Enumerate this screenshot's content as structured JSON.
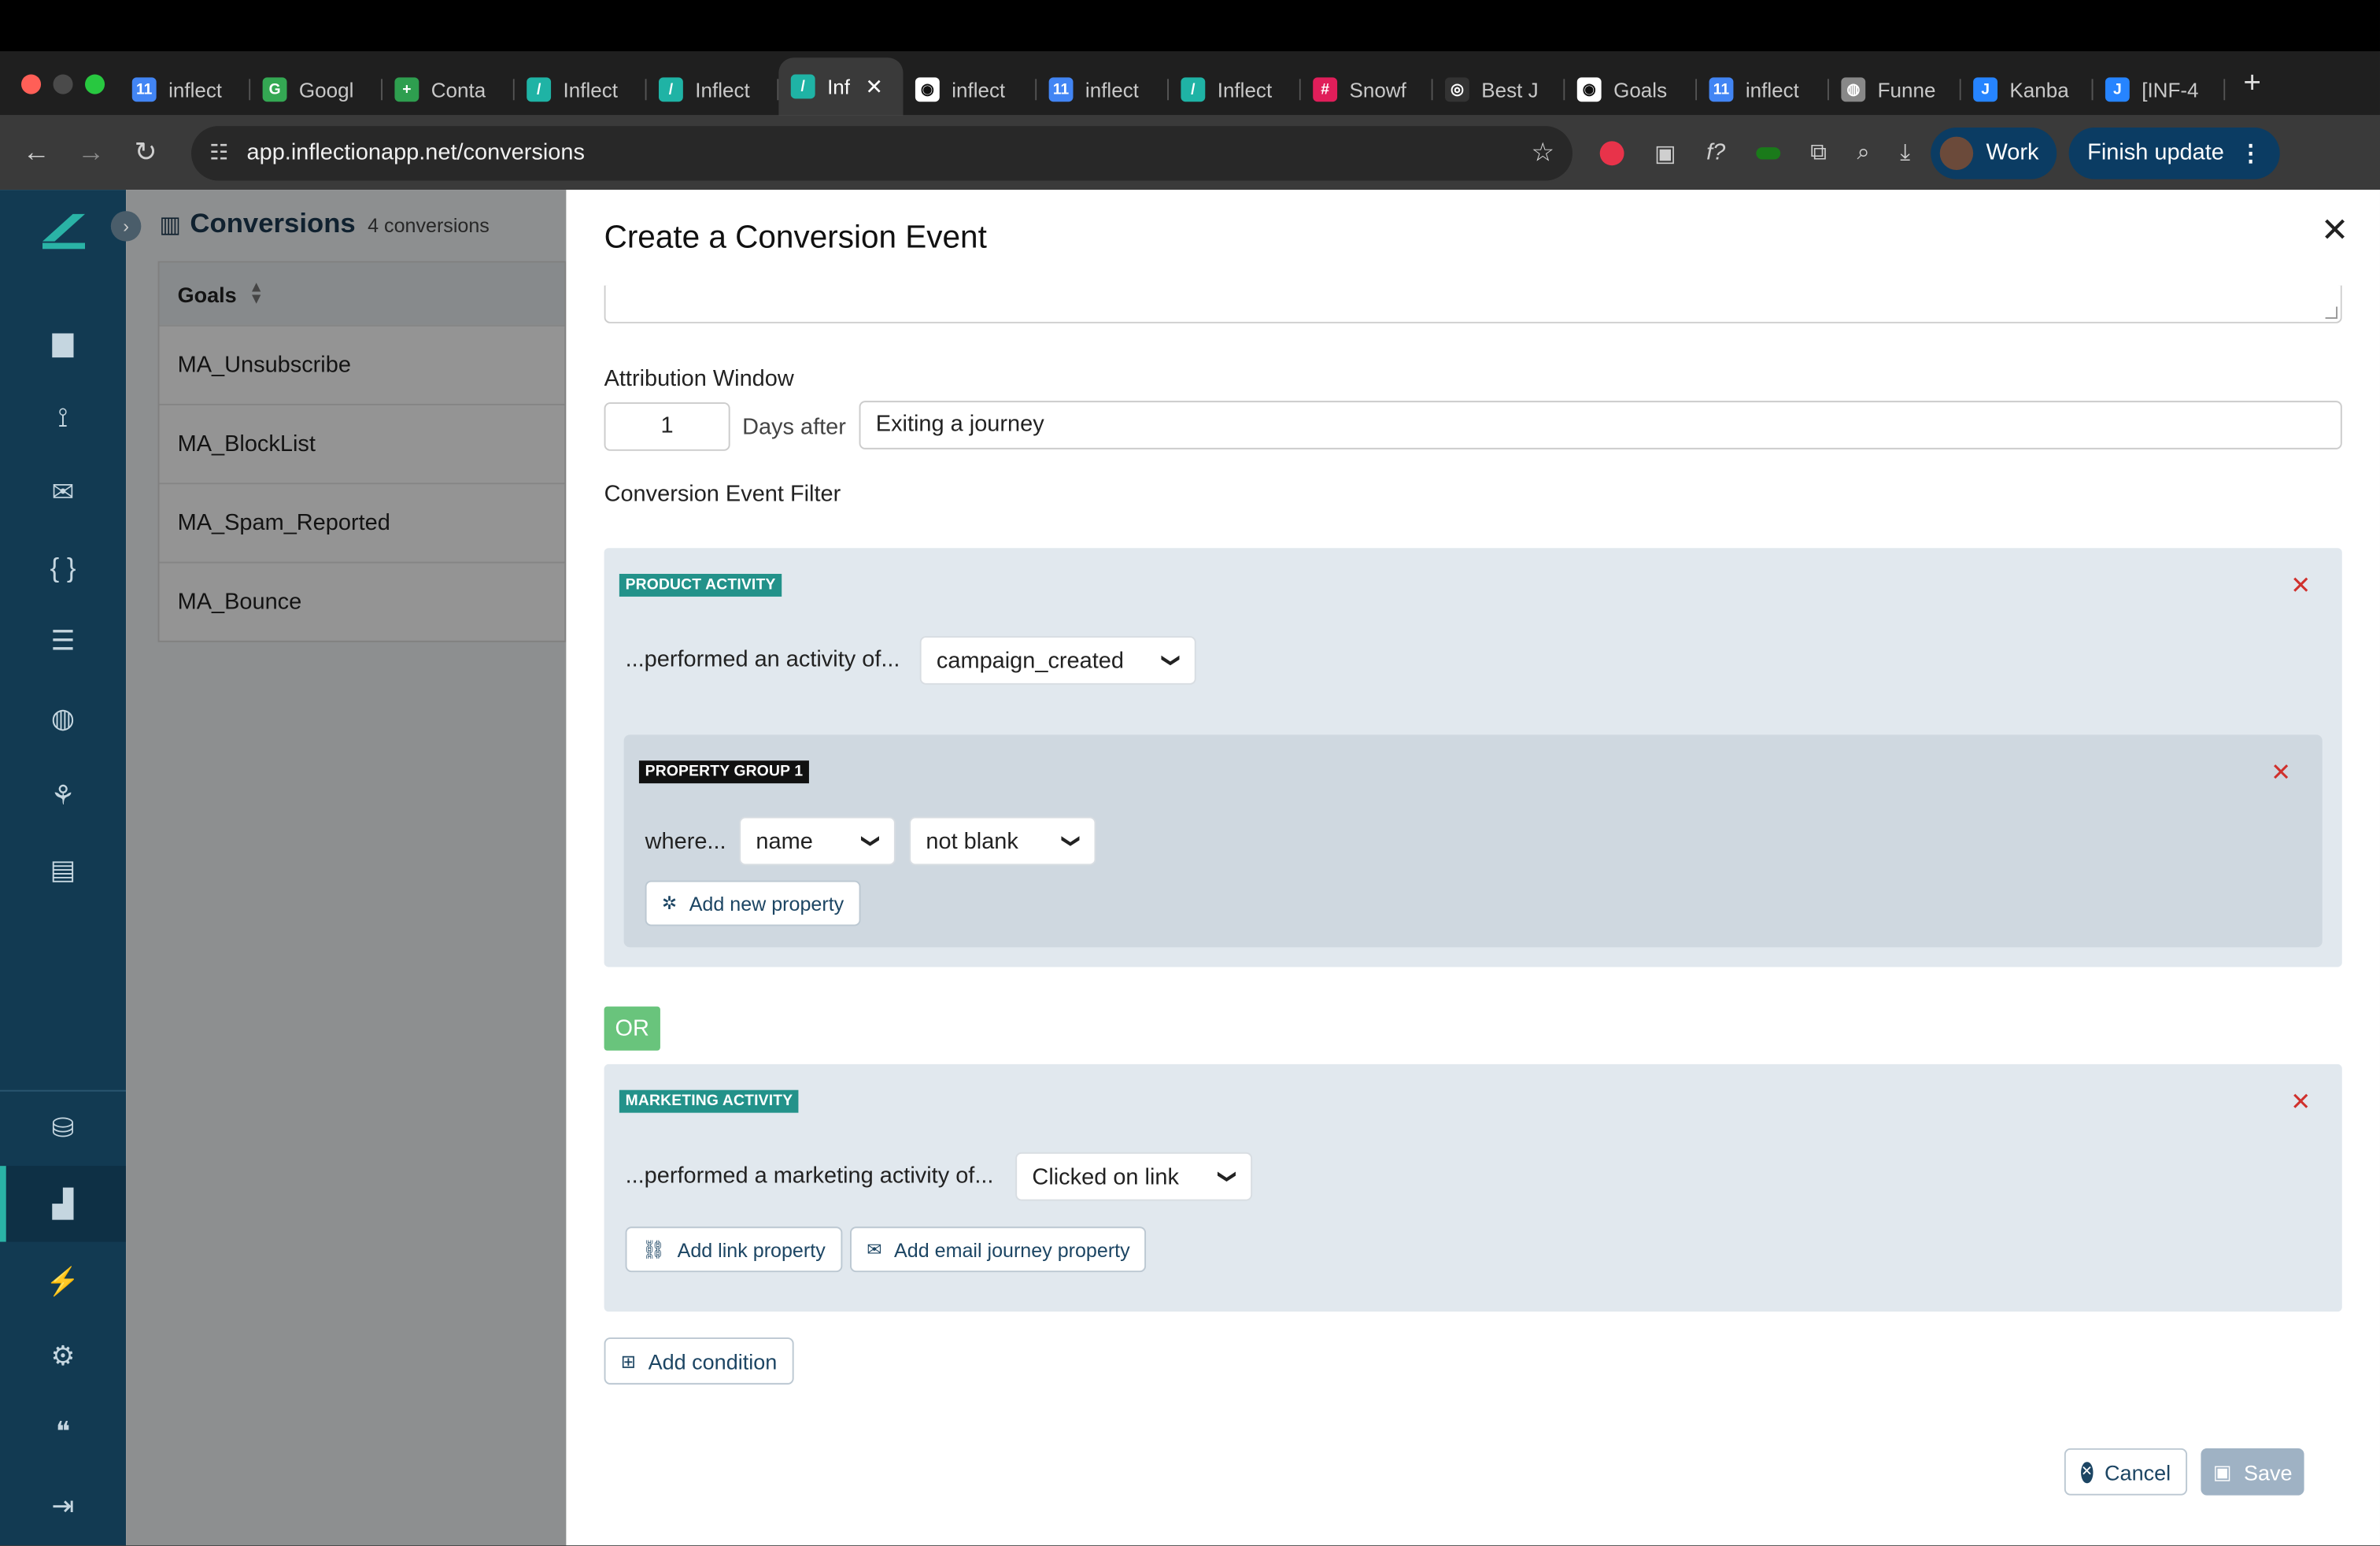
{
  "browser": {
    "tabs": [
      {
        "title": "inflect",
        "fav_color": "#4285f4",
        "fav_glyph": "11"
      },
      {
        "title": "Googl",
        "fav_color": "#34a853",
        "fav_glyph": "G"
      },
      {
        "title": "Conta",
        "fav_color": "#2e9e4f",
        "fav_glyph": "+"
      },
      {
        "title": "Inflect",
        "fav_color": "#1fb3a5",
        "fav_glyph": "/"
      },
      {
        "title": "Inflect",
        "fav_color": "#1fb3a5",
        "fav_glyph": "/"
      },
      {
        "title": "Inf",
        "fav_color": "#1fb3a5",
        "fav_glyph": "/",
        "active": true
      },
      {
        "title": "inflect",
        "fav_color": "#ffffff",
        "fav_glyph": "◉"
      },
      {
        "title": "inflect",
        "fav_color": "#4285f4",
        "fav_glyph": "11"
      },
      {
        "title": "Inflect",
        "fav_color": "#1fb3a5",
        "fav_glyph": "/"
      },
      {
        "title": "Snowf",
        "fav_color": "#e01e5a",
        "fav_glyph": "#"
      },
      {
        "title": "Best J",
        "fav_color": "#333333",
        "fav_glyph": "◎"
      },
      {
        "title": "Goals",
        "fav_color": "#ffffff",
        "fav_glyph": "◉"
      },
      {
        "title": "inflect",
        "fav_color": "#4285f4",
        "fav_glyph": "11"
      },
      {
        "title": "Funne",
        "fav_color": "#888888",
        "fav_glyph": "◍"
      },
      {
        "title": "Kanba",
        "fav_color": "#2684ff",
        "fav_glyph": "J"
      },
      {
        "title": "[INF-4",
        "fav_color": "#2684ff",
        "fav_glyph": "J"
      }
    ],
    "url": "app.inflectionapp.net/conversions",
    "profile_label": "Work",
    "update_label": "Finish update"
  },
  "page": {
    "title": "Conversions",
    "count": "4 conversions",
    "table_header": "Goals",
    "rows": [
      "MA_Unsubscribe",
      "MA_BlockList",
      "MA_Spam_Reported",
      "MA_Bounce"
    ]
  },
  "modal": {
    "title": "Create a Conversion Event",
    "attribution_label": "Attribution Window",
    "attribution_days": "1",
    "days_after": "Days after",
    "trigger": "Exiting a journey",
    "filter_label": "Conversion Event Filter",
    "block1": {
      "badge": "PRODUCT ACTIVITY",
      "phrase": "...performed an activity of...",
      "activity": "campaign_created",
      "group": {
        "badge": "PROPERTY GROUP 1",
        "phrase": "where...",
        "property": "name",
        "operator": "not blank",
        "add_label": "Add new property"
      }
    },
    "or_label": "OR",
    "block2": {
      "badge": "MARKETING ACTIVITY",
      "phrase": "...performed a marketing activity of...",
      "activity": "Clicked on link",
      "add_link": "Add link property",
      "add_email": "Add email journey property"
    },
    "add_condition": "Add condition",
    "cancel": "Cancel",
    "save": "Save"
  },
  "colors": {
    "sidebar": "#123a52",
    "accent": "#23928a",
    "or_green": "#69c47c",
    "remove_red": "#d0312d"
  }
}
